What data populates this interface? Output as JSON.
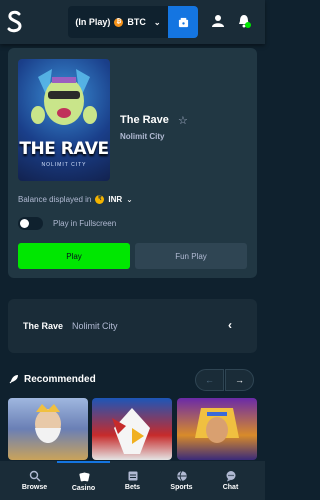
{
  "header": {
    "logo": "S",
    "wallet_label": "(In Play)",
    "currency": "BTC",
    "icons": [
      "wallet-icon",
      "user-icon",
      "notifications-icon"
    ]
  },
  "game": {
    "title": "The Rave",
    "thumb_title": "THE RAVE",
    "thumb_subtitle": "NOLIMIT CITY",
    "provider": "Nolimit City",
    "balance_label": "Balance displayed in",
    "balance_currency": "INR",
    "fullscreen_label": "Play in Fullscreen",
    "fullscreen_enabled": false,
    "play_label": "Play",
    "fun_play_label": "Fun Play"
  },
  "info_panel": {
    "title": "The Rave",
    "provider": "Nolimit City"
  },
  "recommended": {
    "title": "Recommended",
    "prev": "←",
    "next": "→"
  },
  "bottom_nav": {
    "items": [
      {
        "label": "Browse",
        "icon": "browse-icon"
      },
      {
        "label": "Casino",
        "icon": "cards-icon",
        "active": true
      },
      {
        "label": "Bets",
        "icon": "bets-icon"
      },
      {
        "label": "Sports",
        "icon": "sports-ball-icon"
      },
      {
        "label": "Chat",
        "icon": "chat-icon"
      }
    ]
  },
  "colors": {
    "background": "#0f212e",
    "card": "#213743",
    "accent_green": "#00e701",
    "accent_blue": "#1475e1"
  }
}
